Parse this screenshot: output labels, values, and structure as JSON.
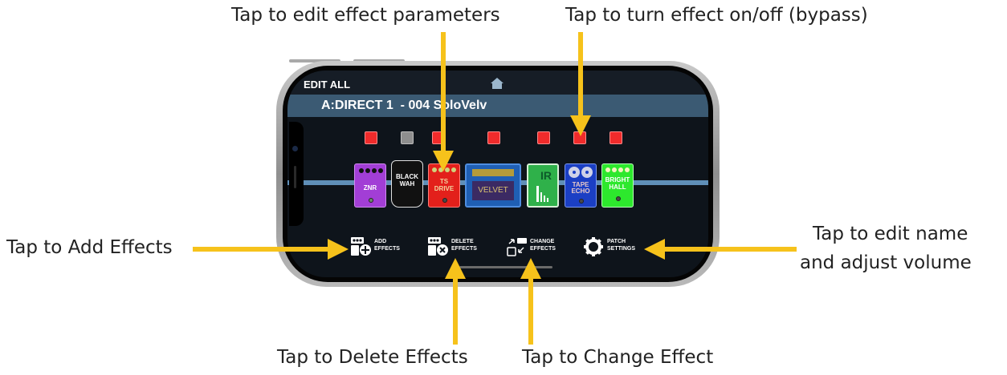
{
  "callouts": {
    "edit_params": "Tap to edit effect parameters",
    "bypass": "Tap to turn effect on/off (bypass)",
    "add": "Tap to Add Effects",
    "edit_name_1": "Tap to edit name",
    "edit_name_2": "and adjust volume",
    "delete": "Tap to Delete Effects",
    "change": "Tap to Change Effect"
  },
  "app": {
    "mode_label": "EDIT ALL",
    "patch_name": "A:DIRECT 1  - 004 SoloVelv"
  },
  "bypass_states": [
    "on",
    "off",
    "on",
    "on",
    "on",
    "on",
    "on"
  ],
  "effects": [
    {
      "name": "ZNR",
      "color": "#a23ed6"
    },
    {
      "name_1": "BLACK",
      "name_2": "WAH",
      "color": "#111111"
    },
    {
      "name_1": "TS",
      "name_2": "DRIVE",
      "color": "#e3201b"
    },
    {
      "name": "VELVET",
      "color": "#1f5fb4"
    },
    {
      "name": "IR",
      "color": "#2fb14a"
    },
    {
      "name_1": "TAPE",
      "name_2": "ECHO",
      "color": "#1b3fc4"
    },
    {
      "name_1": "BRIGHT",
      "name_2": "HALL",
      "color": "#2de82d"
    }
  ],
  "toolbar": {
    "add_1": "ADD",
    "add_2": "EFFECTS",
    "delete_1": "DELETE",
    "delete_2": "EFFECTS",
    "change_1": "CHANGE",
    "change_2": "EFFECTS",
    "settings_1": "PATCH",
    "settings_2": "SETTINGS"
  },
  "colors": {
    "arrow": "#f6c21b",
    "bypass_on": "#f02b2b",
    "bypass_off": "#8e8e8e",
    "chain_line": "#5f8fb8",
    "patch_bar": "#3b5a73"
  }
}
